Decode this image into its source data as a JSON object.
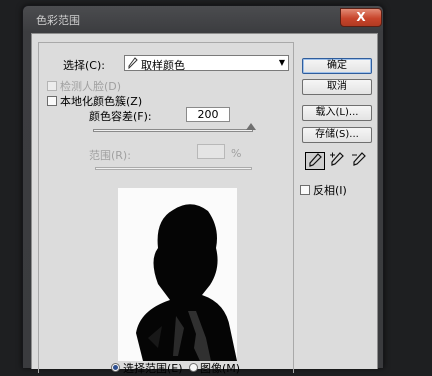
{
  "dialog": {
    "title": "色彩范围",
    "close_glyph": "X"
  },
  "select": {
    "label": "选择(C):",
    "value": "取样颜色",
    "icon": "eyedropper-icon"
  },
  "detect_faces": {
    "label": "检测人脸(D)",
    "checked": false,
    "enabled": false
  },
  "localized_clusters": {
    "label": "本地化颜色簇(Z)",
    "checked": false
  },
  "fuzziness": {
    "label": "颜色容差(F):",
    "value": "200"
  },
  "range": {
    "label": "范围(R):",
    "value": "",
    "unit": "%"
  },
  "buttons": {
    "ok": "确定",
    "cancel": "取消",
    "load": "载入(L)...",
    "save": "存储(S)..."
  },
  "eyedroppers": [
    "eyedropper-icon",
    "eyedropper-plus-icon",
    "eyedropper-minus-icon"
  ],
  "invert": {
    "label": "反相(I)",
    "checked": false
  },
  "view": {
    "selection_label": "选择范围(E)",
    "image_label": "图像(M)",
    "selected": "selection"
  },
  "colors": {
    "frame": "#3c3d40",
    "client": "#dcdcdc",
    "close": "#c8452c",
    "focus": "#2f5d9c"
  }
}
